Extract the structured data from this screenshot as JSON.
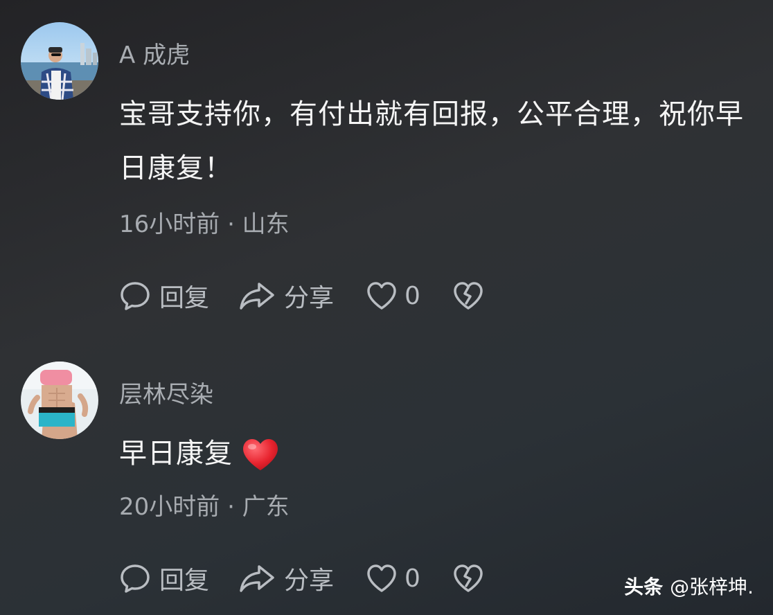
{
  "comments": [
    {
      "username": "A 成虎",
      "text": "宝哥支持你，有付出就有回报，公平合理，祝你早日康复！",
      "time_location": "16小时前 · 山东",
      "reply_label": "回复",
      "share_label": "分享",
      "like_count": "0"
    },
    {
      "username": "层林尽染",
      "text": "早日康复",
      "emoji": "red-heart",
      "time_location": "20小时前 · 广东",
      "reply_label": "回复",
      "share_label": "分享",
      "like_count": "0"
    }
  ],
  "watermark": {
    "brand": "头条",
    "handle": "@张梓坤."
  },
  "colors": {
    "text_primary": "#f5f5f5",
    "text_secondary": "#a7abb0",
    "heart_emoji": "#e8242f"
  }
}
